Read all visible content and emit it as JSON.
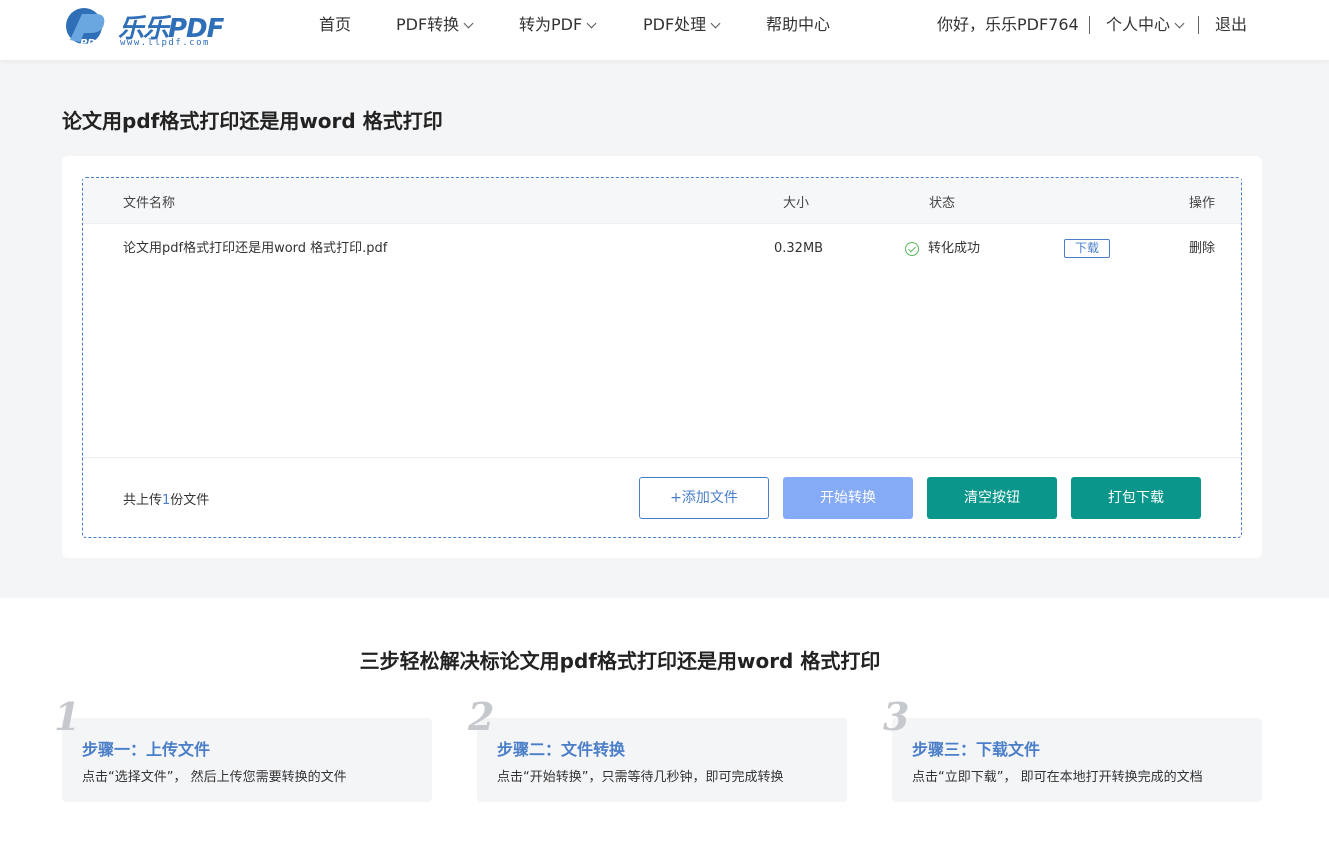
{
  "brand": {
    "logo_mark": "PDF",
    "name": "乐乐PDF",
    "url": "www.llpdf.com",
    "color": "#2f6fb7"
  },
  "nav": {
    "home": "首页",
    "pdf_convert": "PDF转换",
    "to_pdf": "转为PDF",
    "pdf_process": "PDF处理",
    "help": "帮助中心"
  },
  "user": {
    "greeting": "你好，乐乐PDF764",
    "center": "个人中心",
    "logout": "退出"
  },
  "page": {
    "title": "论文用pdf格式打印还是用word 格式打印"
  },
  "table": {
    "headers": {
      "name": "文件名称",
      "size": "大小",
      "status": "状态",
      "action": "操作"
    },
    "rows": [
      {
        "name": "论文用pdf格式打印还是用word 格式打印.pdf",
        "size": "0.32MB",
        "status": "转化成功",
        "download": "下载",
        "delete": "删除"
      }
    ]
  },
  "footer": {
    "count_prefix": "共上传",
    "count": "1",
    "count_suffix": "份文件",
    "add_file": "+添加文件",
    "start": "开始转换",
    "clear": "清空按钮",
    "pack_download": "打包下载"
  },
  "steps": {
    "title": "三步轻松解决标论文用pdf格式打印还是用word 格式打印",
    "items": [
      {
        "num": "1",
        "head": "步骤一：上传文件",
        "desc": "点击“选择文件”， 然后上传您需要转换的文件"
      },
      {
        "num": "2",
        "head": "步骤二：文件转换",
        "desc": "点击“开始转换”，只需等待几秒钟，即可完成转换"
      },
      {
        "num": "3",
        "head": "步骤三：下载文件",
        "desc": "点击“立即下载”， 即可在本地打开转换完成的文档"
      }
    ]
  },
  "colors": {
    "accent": "#4a7ec8",
    "start_button": "#85aaf6",
    "teal_button": "#0a968a",
    "success": "#5cb85c"
  }
}
